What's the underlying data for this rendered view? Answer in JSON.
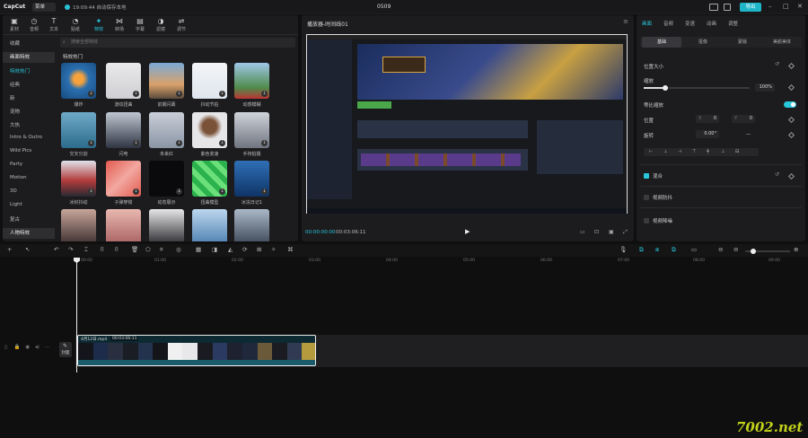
{
  "titlebar": {
    "logo": "CapCut",
    "menu": "菜单",
    "autosave": "19:09:44 自动保存本地",
    "title": "0509",
    "export": "导出"
  },
  "tools": [
    {
      "label": "素材",
      "icon": "▣"
    },
    {
      "label": "音频",
      "icon": "◷"
    },
    {
      "label": "文本",
      "icon": "T"
    },
    {
      "label": "贴纸",
      "icon": "◔"
    },
    {
      "label": "特效",
      "icon": "✦"
    },
    {
      "label": "转场",
      "icon": "⋈"
    },
    {
      "label": "字幕",
      "icon": "▤"
    },
    {
      "label": "滤镜",
      "icon": "◑"
    },
    {
      "label": "调节",
      "icon": "⇌"
    }
  ],
  "categories": [
    "收藏",
    "画面特效",
    "特效热门",
    "经典",
    "新",
    "宠物",
    "大热",
    "Intro & Outro",
    "Wild Pics",
    "Party",
    "Motion",
    "3D",
    "Light",
    "复古",
    "人物特效"
  ],
  "search_placeholder": "搜索全部特效",
  "section_title": "特效热门",
  "effects": [
    "爆炸",
    "波纹扭曲",
    "前期闪幕",
    "抖动节拍",
    "动感模糊",
    "交叉分割",
    "闪电",
    "未来红",
    "紫色变速",
    "手持拍摄",
    "冰封抖动",
    "子弹穿梭",
    "动态展示",
    "扭曲模型",
    "冰冻日记1",
    "",
    "",
    "",
    "",
    ""
  ],
  "player": {
    "title": "播放器-时间线01",
    "time_current": "00:00:00:00",
    "time_total": "00:03:06:11"
  },
  "right": {
    "tabs": [
      "画面",
      "音频",
      "变速",
      "动画",
      "调整"
    ],
    "subtabs": [
      "基础",
      "抠像",
      "蒙版",
      "美颜美体"
    ],
    "position_size": "位置大小",
    "scale_label": "缩放",
    "scale_value": "100%",
    "uniform_label": "等比缩放",
    "position_label": "位置",
    "x_label": "X",
    "x_value": "0",
    "y_label": "Y",
    "y_value": "0",
    "rotate_label": "旋转",
    "rotate_value": "0.00°",
    "rotate_extra": "—",
    "blend_label": "混合",
    "stabilize_label": "视频防抖",
    "denoise_label": "视频降噪"
  },
  "timeline": {
    "ticks": [
      "00:00",
      "01:00",
      "02:00",
      "03:00",
      "04:00",
      "05:00",
      "06:00",
      "07:00",
      "08:00",
      "09:00"
    ],
    "cover_label": "封面",
    "clip_name": "4月12日.mp4",
    "clip_duration": "00:03:06:11"
  },
  "watermark": "7002.net"
}
